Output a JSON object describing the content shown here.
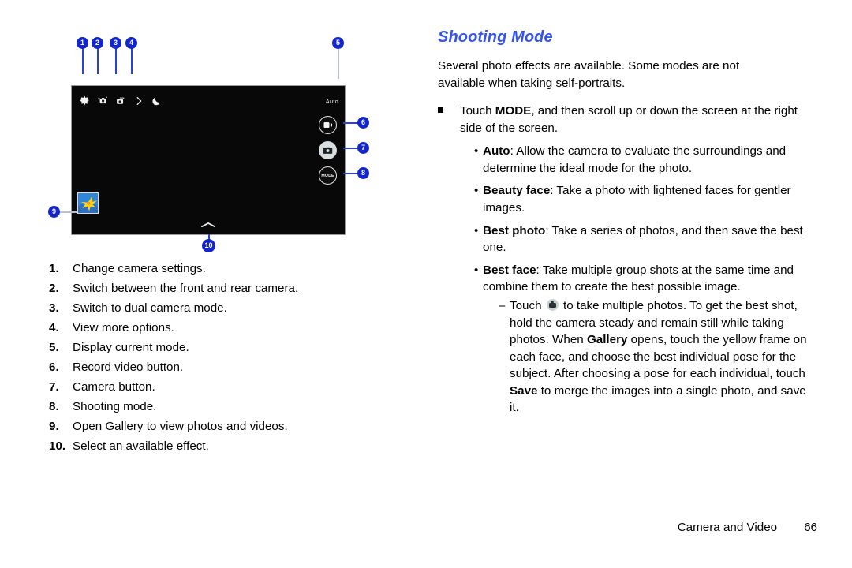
{
  "page": {
    "footer_section": "Camera and Video",
    "footer_page_number": "66"
  },
  "figure": {
    "toolbar_icons": [
      {
        "name": "settings-gear-icon",
        "label": "Change camera settings"
      },
      {
        "name": "switch-camera-icon",
        "label": "Switch between front and rear camera"
      },
      {
        "name": "dual-camera-icon",
        "label": "Switch to dual camera mode"
      },
      {
        "name": "chevron-right-icon",
        "label": "View more options"
      },
      {
        "name": "night-mode-icon",
        "label": "Effect"
      }
    ],
    "mode_label": "Auto",
    "mode_button_label": "MODE",
    "buttons": [
      {
        "name": "record-video-button",
        "label": ""
      },
      {
        "name": "camera-shutter-button",
        "label": ""
      },
      {
        "name": "shooting-mode-button",
        "label": "MODE"
      }
    ],
    "gallery_thumbnail_name": "gallery-thumbnail",
    "effects-chevron": "effects-chevron-up-icon",
    "callouts": [
      "1",
      "2",
      "3",
      "4",
      "5",
      "6",
      "7",
      "8",
      "9",
      "10"
    ]
  },
  "legend": {
    "items": [
      {
        "num": "1.",
        "text": "Change camera settings."
      },
      {
        "num": "2.",
        "text": "Switch between the front and rear camera."
      },
      {
        "num": "3.",
        "text": "Switch to dual camera mode."
      },
      {
        "num": "4.",
        "text": "View more options."
      },
      {
        "num": "5.",
        "text": "Display current mode."
      },
      {
        "num": "6.",
        "text": "Record video button."
      },
      {
        "num": "7.",
        "text": "Camera button."
      },
      {
        "num": "8.",
        "text": "Shooting mode."
      },
      {
        "num": "9.",
        "text": "Open Gallery to view photos and videos."
      },
      {
        "num": "10.",
        "text": "Select an available effect."
      }
    ]
  },
  "section": {
    "heading": "Shooting Mode",
    "intro": "Several photo effects are available. Some modes are not available when taking self-portraits.",
    "main_bullet": {
      "pre": "Touch ",
      "bold": "MODE",
      "post": ", and then scroll up or down the screen at the right side of the screen."
    },
    "modes": [
      {
        "marker": "•",
        "name": "Auto",
        "desc": ": Allow the camera to evaluate the surroundings and determine the ideal mode for the photo."
      },
      {
        "marker": "•",
        "name": "Beauty face",
        "desc": ": Take a photo with lightened faces for gentler images."
      },
      {
        "marker": "•",
        "name": "Best photo",
        "desc": ": Take a series of photos, and then save the best one."
      },
      {
        "marker": "•",
        "name": "Best face",
        "desc": ": Take multiple group shots at the same time and combine them to create the best possible image."
      }
    ],
    "best_face_detail": {
      "marker": "–",
      "part1": "Touch ",
      "part2": " to take multiple photos. To get the best shot, hold the camera steady and remain still while taking photos. When ",
      "bold1": "Gallery",
      "part3": " opens, touch the yellow frame on each face, and choose the best individual pose for the subject. After choosing a pose for each individual, touch ",
      "bold2": "Save",
      "part4": " to merge the images into a single photo, and save it."
    }
  },
  "colors": {
    "heading_blue": "#3355ee",
    "callout_blue": "#1226cc",
    "preview_black": "#080808",
    "thumb_blue": "#2c7fd4",
    "thumb_yellow": "#ffcc22"
  }
}
